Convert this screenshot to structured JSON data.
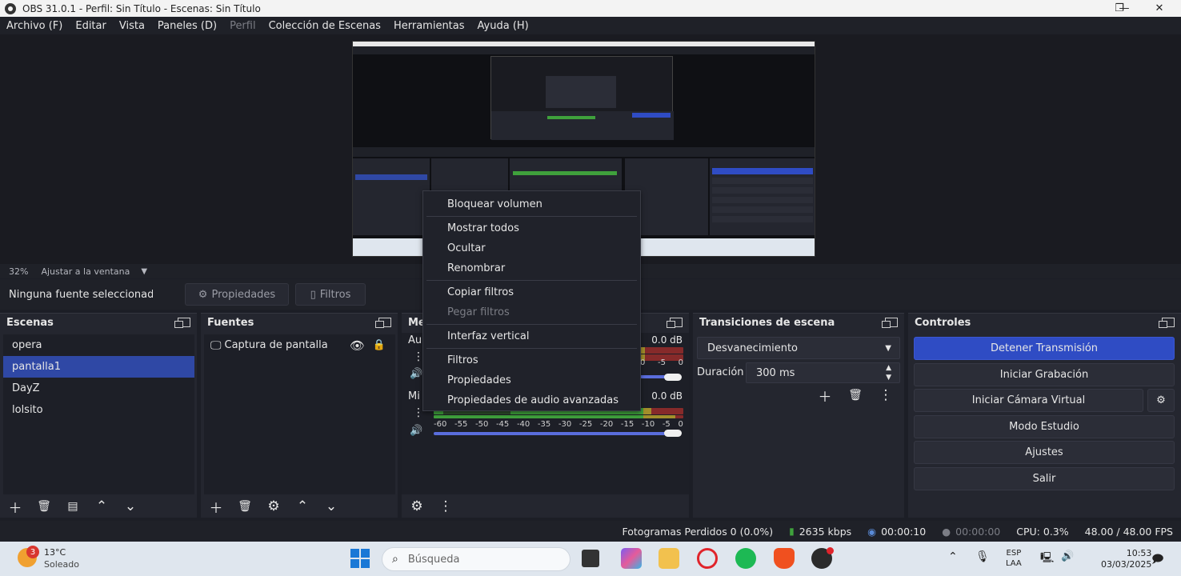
{
  "window": {
    "title": "OBS 31.0.1 - Perfil: Sin Título - Escenas: Sin Título",
    "controls": [
      "—",
      "❐",
      "✕"
    ]
  },
  "menu": [
    "Archivo (F)",
    "Editar",
    "Vista",
    "Paneles (D)",
    "Perfil",
    "Colección de Escenas",
    "Herramientas",
    "Ayuda (H)"
  ],
  "zoom": {
    "percent": "32%",
    "fit_label": "Ajustar a la ventana"
  },
  "source_bar": {
    "selected": "Ninguna fuente seleccionada",
    "properties": "Propiedades",
    "filters": "Filtros"
  },
  "scenes": {
    "title": "Escenas",
    "items": [
      "opera",
      "pantalla1",
      "DayZ",
      "lolsito"
    ],
    "selected_index": 1
  },
  "sources": {
    "title": "Fuentes",
    "items": [
      {
        "name": "Captura de pantalla",
        "visible": true,
        "locked": true
      }
    ]
  },
  "mixer": {
    "title": "Me",
    "channels": [
      {
        "name": "Au",
        "db": "0.0 dB"
      },
      {
        "name": "Mi",
        "db": "0.0 dB"
      }
    ],
    "scale": [
      "-60",
      "-55",
      "-50",
      "-45",
      "-40",
      "-35",
      "-30",
      "-25",
      "-20",
      "-15",
      "-10",
      "-5",
      "0"
    ],
    "scale_partial": [
      "0",
      "-5",
      "0"
    ]
  },
  "transitions": {
    "title": "Transiciones de escena",
    "selected": "Desvanecimiento",
    "duration_label": "Duración",
    "duration_value": "300 ms"
  },
  "controls": {
    "title": "Controles",
    "buttons": [
      "Detener Transmisión",
      "Iniciar Grabación",
      "Iniciar Cámara Virtual",
      "Modo Estudio",
      "Ajustes",
      "Salir"
    ]
  },
  "context_menu": {
    "groups": [
      [
        "Bloquear volumen"
      ],
      [
        "Mostrar todos",
        "Ocultar",
        "Renombrar"
      ],
      [
        "Copiar filtros",
        "Pegar filtros"
      ],
      [
        "Interfaz vertical"
      ],
      [
        "Filtros",
        "Propiedades",
        "Propiedades de audio avanzadas"
      ]
    ],
    "disabled": [
      "Pegar filtros"
    ]
  },
  "status": {
    "dropped": "Fotogramas Perdidos 0 (0.0%)",
    "bitrate": "2635 kbps",
    "stream_time": "00:00:10",
    "rec_time": "00:00:00",
    "cpu": "CPU: 0.3%",
    "fps": "48.00 / 48.00 FPS"
  },
  "taskbar": {
    "weather_badge": "3",
    "temp": "13°C",
    "condition": "Soleado",
    "search_placeholder": "Búsqueda",
    "lang1": "ESP",
    "lang2": "LAA",
    "time": "10:53",
    "date": "03/03/2025"
  },
  "colors": {
    "accent": "#2f4cc4",
    "selected": "#2f48a5",
    "bg": "#1c1e26"
  }
}
